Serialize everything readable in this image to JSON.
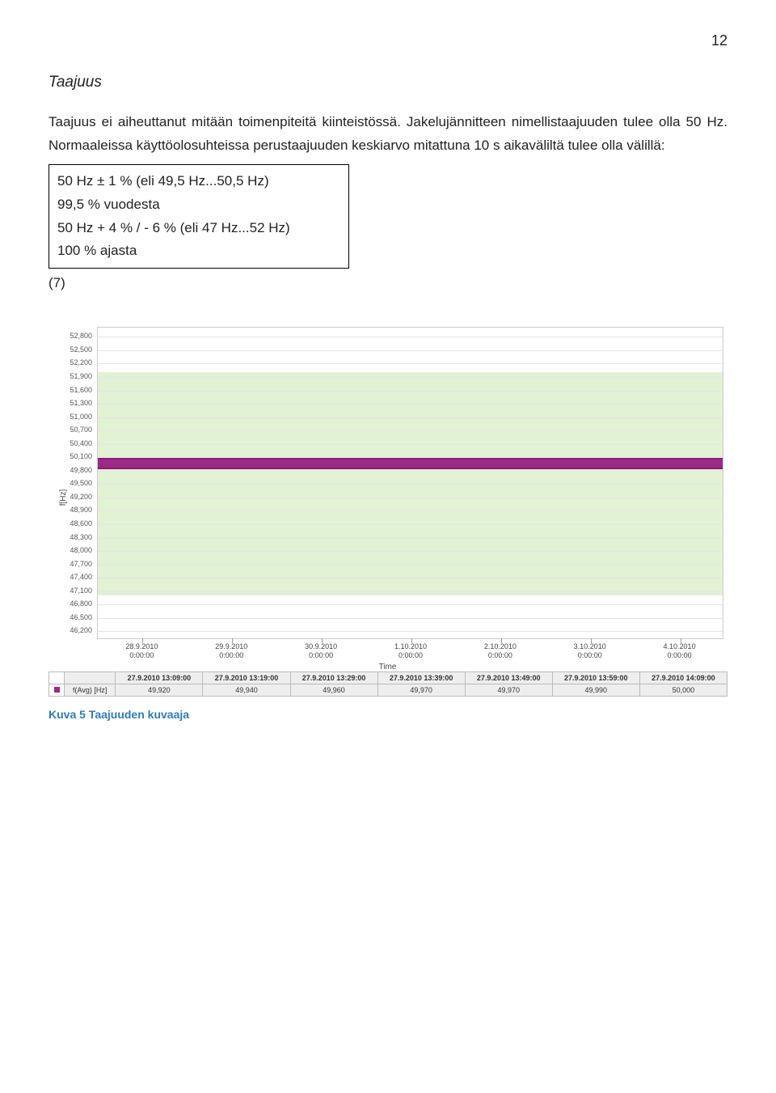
{
  "page_number": "12",
  "heading": "Taajuus",
  "paragraph": "Taajuus ei aiheuttanut mitään toimenpiteitä kiinteistössä. Jakelujännitteen nimellistaajuuden tulee olla 50 Hz. Normaaleissa käyttöolosuhteissa perustaajuuden keskiarvo mitattuna 10 s aikaväliltä tulee olla välillä:",
  "box_line1": "50 Hz ± 1 % (eli 49,5 Hz...50,5 Hz)",
  "box_line2": "99,5 % vuodesta",
  "box_line3": "50 Hz + 4 % / - 6 % (eli 47 Hz...52 Hz)",
  "box_line4": "100 % ajasta",
  "ref": "(7)",
  "caption": "Kuva 5 Taajuuden kuvaaja",
  "chart_data": {
    "type": "line",
    "ylabel": "f[Hz]",
    "xlabel": "Time",
    "y_ticks": [
      "52,800",
      "52,500",
      "52,200",
      "51,900",
      "51,600",
      "51,300",
      "51,000",
      "50,700",
      "50,400",
      "50,100",
      "49,800",
      "49,500",
      "49,200",
      "48,900",
      "48,600",
      "48,300",
      "48,000",
      "47,700",
      "47,400",
      "47,100",
      "46,800",
      "46,500",
      "46,200"
    ],
    "ylim": [
      46.0,
      53.0
    ],
    "green_band_y": [
      47.0,
      52.0
    ],
    "x_tick_labels_top": [
      "28.9.2010",
      "29.9.2010",
      "30.9.2010",
      "1.10.2010",
      "2.10.2010",
      "3.10.2010",
      "4.10.2010"
    ],
    "x_tick_labels_bottom": [
      "0:00:00",
      "0:00:00",
      "0:00:00",
      "0:00:00",
      "0:00:00",
      "0:00:00",
      "0:00:00"
    ],
    "series": [
      {
        "name": "f(Avg) [Hz]",
        "approx_value": 49.96
      }
    ],
    "legend_columns": [
      "27.9.2010 13:09:00",
      "27.9.2010 13:19:00",
      "27.9.2010 13:29:00",
      "27.9.2010 13:39:00",
      "27.9.2010 13:49:00",
      "27.9.2010 13:59:00",
      "27.9.2010 14:09:00"
    ],
    "legend_values": [
      "49,920",
      "49,940",
      "49,960",
      "49,970",
      "49,970",
      "49,990",
      "50,000"
    ]
  }
}
